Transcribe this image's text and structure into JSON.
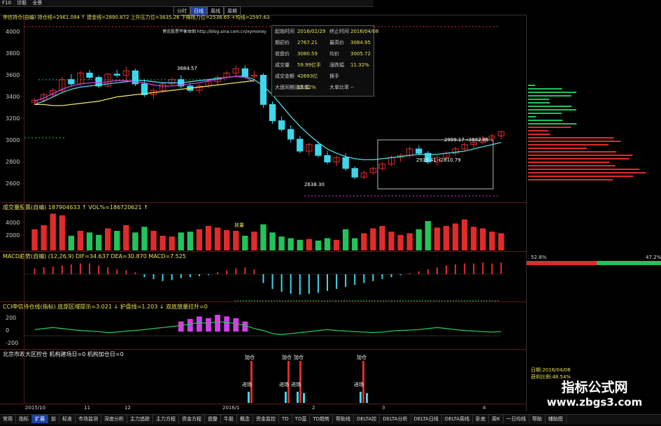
{
  "app": {
    "title": "F10",
    "tabs": [
      "诊股",
      "全景"
    ]
  },
  "period_buttons": [
    "分时",
    "日线",
    "周线",
    "周期"
  ],
  "price_panel": {
    "header": "申信持仓(自编) 持仓线=2961.094 ↑ 建金线=2890.872 上升压力位=3635.26 下降阻力位=2538.65 +均线=2597.63",
    "y_ticks": [
      "4000",
      "3800",
      "3600",
      "3400",
      "3200",
      "3000",
      "2800",
      "2600"
    ],
    "labels": {
      "high": "3684.57",
      "low": "2638.30",
      "mid": "2999.17→3882.85",
      "mid2": "2915.41→2810.79",
      "blog": "博克股票平衡体图  http://blog.sina.com.cn/xymoney"
    }
  },
  "info_box": {
    "rows": [
      [
        "起始时间",
        "2016/02/29",
        "终止时间",
        "2016/04/08"
      ],
      [
        "期初价",
        "2767.21",
        "最高价",
        "3084.95"
      ],
      [
        "收盘价",
        "3080.59",
        "均价",
        "3005.72"
      ],
      [
        "成交量",
        "59.99亿手",
        "涨跌幅",
        "11.32%"
      ],
      [
        "成交金额",
        "42693亿",
        "换手",
        ""
      ],
      [
        "大盘同期涨跌幅",
        "11.32%",
        "大单比率",
        "--"
      ]
    ]
  },
  "volume_panel": {
    "header": "成交量股票(自编)  187904633 ↑ VOL%=186720621 ↑",
    "y_ticks": [
      "4000",
      "2000"
    ],
    "label": "放量"
  },
  "macd_panel": {
    "header": "MACD趋势(自编) (12,26,9) DIF=34.637 DEA=30.870 MACD=7.525"
  },
  "cci_panel": {
    "header": "CCI申信持仓线(指标) 底部区域提示=3.021 ↓ 护盘线=1.203 ↓ 双底放量拉升=0",
    "y_ticks": [
      "200",
      "0",
      "-200"
    ]
  },
  "bottom_panel": {
    "header": "北京市政大区控仓 机构建场日=0 机构加仓日=0",
    "labels": [
      "加仓",
      "进场",
      "加仓",
      "进场",
      "加仓",
      "进场",
      "加仓",
      "进场"
    ]
  },
  "time_axis": [
    "2015/10",
    "11",
    "12",
    "2016/1",
    "2",
    "3",
    "4"
  ],
  "right_panel": {
    "left_pct": "52.8%",
    "right_pct": "47.2%",
    "date": "日期:2016/04/08",
    "profit": "获利比例:48.54%"
  },
  "bottom_tabs": [
    "常用",
    "指标",
    "扩展",
    "前",
    "标准",
    "市场监测",
    "深度分析",
    "主力追踪",
    "主力方程",
    "资金方程",
    "盘整",
    "牛股",
    "概念",
    "资金监控",
    "TD",
    "TD蓝",
    "TD趋势",
    "帮助线",
    "DELTA控",
    "DELTA分析",
    "DELTA日线",
    "DELTA周线",
    "卧底",
    "周K",
    "一日均线",
    "帮助",
    "辅助图"
  ],
  "watermark": {
    "line1": "指标公式网",
    "line2": "www.zbgs3.com"
  },
  "colors": {
    "up": "#e02b2b",
    "down": "#3fd6ec",
    "ma_purple": "#d23fe6",
    "ma_yellow": "#e8e25a",
    "ma_cyan": "#4fd9e6",
    "green": "#22c35a",
    "grid": "#5a1a1a"
  },
  "chart_data": {
    "type": "candlestick",
    "ylim": [
      2500,
      4100
    ],
    "candles": [
      [
        3350,
        3390,
        3320,
        3370
      ],
      [
        3370,
        3440,
        3350,
        3420
      ],
      [
        3420,
        3480,
        3400,
        3460
      ],
      [
        3460,
        3580,
        3440,
        3560
      ],
      [
        3560,
        3610,
        3500,
        3520
      ],
      [
        3520,
        3640,
        3500,
        3620
      ],
      [
        3620,
        3650,
        3560,
        3580
      ],
      [
        3580,
        3600,
        3480,
        3500
      ],
      [
        3500,
        3620,
        3490,
        3610
      ],
      [
        3610,
        3650,
        3580,
        3600
      ],
      [
        3600,
        3680,
        3560,
        3640
      ],
      [
        3640,
        3660,
        3500,
        3520
      ],
      [
        3520,
        3560,
        3400,
        3420
      ],
      [
        3420,
        3480,
        3380,
        3460
      ],
      [
        3460,
        3540,
        3440,
        3520
      ],
      [
        3520,
        3580,
        3500,
        3560
      ],
      [
        3560,
        3600,
        3480,
        3500
      ],
      [
        3500,
        3530,
        3440,
        3460
      ],
      [
        3460,
        3520,
        3430,
        3500
      ],
      [
        3500,
        3560,
        3480,
        3540
      ],
      [
        3540,
        3600,
        3510,
        3580
      ],
      [
        3580,
        3640,
        3560,
        3620
      ],
      [
        3620,
        3690,
        3590,
        3660
      ],
      [
        3660,
        3690,
        3570,
        3590
      ],
      [
        3590,
        3640,
        3560,
        3600
      ],
      [
        3600,
        3620,
        3300,
        3330
      ],
      [
        3330,
        3360,
        3150,
        3180
      ],
      [
        3180,
        3220,
        3080,
        3100
      ],
      [
        3100,
        3140,
        2980,
        3010
      ],
      [
        3010,
        3040,
        2880,
        2900
      ],
      [
        2900,
        2980,
        2860,
        2960
      ],
      [
        2960,
        2990,
        2840,
        2860
      ],
      [
        2860,
        2900,
        2780,
        2800
      ],
      [
        2800,
        2860,
        2760,
        2840
      ],
      [
        2840,
        2880,
        2720,
        2740
      ],
      [
        2740,
        2760,
        2640,
        2660
      ],
      [
        2660,
        2720,
        2638,
        2700
      ],
      [
        2700,
        2760,
        2680,
        2740
      ],
      [
        2740,
        2800,
        2720,
        2780
      ],
      [
        2780,
        2860,
        2760,
        2840
      ],
      [
        2840,
        2880,
        2800,
        2860
      ],
      [
        2860,
        2940,
        2840,
        2920
      ],
      [
        2920,
        2950,
        2860,
        2880
      ],
      [
        2880,
        2900,
        2780,
        2800
      ],
      [
        2800,
        2860,
        2767,
        2840
      ],
      [
        2840,
        2900,
        2820,
        2880
      ],
      [
        2880,
        2940,
        2860,
        2920
      ],
      [
        2920,
        2980,
        2900,
        2960
      ],
      [
        2960,
        3000,
        2930,
        2980
      ],
      [
        2980,
        3040,
        2960,
        3020
      ],
      [
        3020,
        3060,
        2990,
        3040
      ],
      [
        3040,
        3085,
        3010,
        3080
      ]
    ],
    "ma_cyan": [
      3330,
      3360,
      3400,
      3440,
      3470,
      3490,
      3500,
      3510,
      3520,
      3530,
      3540,
      3550,
      3550,
      3540,
      3530,
      3530,
      3530,
      3540,
      3550,
      3560,
      3570,
      3580,
      3590,
      3590,
      3560,
      3500,
      3420,
      3320,
      3220,
      3130,
      3050,
      2980,
      2920,
      2880,
      2850,
      2830,
      2820,
      2820,
      2830,
      2840,
      2850,
      2860,
      2870,
      2870,
      2870,
      2880,
      2890,
      2900,
      2920,
      2940,
      2960,
      2980
    ],
    "ma_purple": [
      3360,
      3390,
      3430,
      3470,
      3500,
      3520,
      3530,
      3530,
      3540,
      3550,
      3550,
      3540,
      3530,
      3510,
      3500,
      3500,
      3510,
      3520,
      3530,
      3550,
      3560,
      3580,
      3590,
      3580,
      3540
    ],
    "ma_yellow": [
      3330,
      3330,
      3320,
      3320,
      3330,
      3340,
      3350,
      3360,
      3380,
      3400,
      3410,
      3420,
      3430,
      3440,
      3450,
      3460,
      3470,
      3480,
      3490,
      3500,
      3510,
      3520,
      3530,
      3540,
      3550
    ],
    "volumes": [
      2600,
      3100,
      4500,
      4300,
      1800,
      2400,
      2200,
      1900,
      2700,
      2400,
      3100,
      2200,
      2900,
      2400,
      1800,
      1700,
      2200,
      2300,
      2600,
      3000,
      2800,
      2500,
      2400,
      1800,
      2300,
      3200,
      2200,
      1700,
      1500,
      1300,
      1400,
      1200,
      1500,
      1300,
      2600,
      1500,
      2100,
      2700,
      3000,
      2300,
      1900,
      2100,
      2600,
      3600,
      2800,
      3000,
      3300,
      3800,
      2900,
      2700,
      2300,
      2100
    ],
    "macd": [
      12,
      14,
      16,
      18,
      20,
      22,
      22,
      18,
      14,
      10,
      8,
      4,
      -6,
      -10,
      -14,
      -12,
      -8,
      -6,
      -4,
      -2,
      4,
      8,
      12,
      14,
      10,
      -18,
      -30,
      -36,
      -40,
      -42,
      -40,
      -38,
      -34,
      -30,
      -26,
      -22,
      -18,
      -14,
      -10,
      -6,
      -2,
      2,
      6,
      10,
      14,
      18,
      20,
      22,
      22,
      24,
      22,
      24
    ],
    "cci": [
      40,
      60,
      80,
      60,
      40,
      20,
      10,
      0,
      -20,
      -10,
      10,
      20,
      40,
      60,
      80,
      100,
      120,
      150,
      180,
      160,
      200,
      180,
      160,
      120,
      60,
      20,
      -40,
      -60,
      -40,
      -20,
      0,
      20,
      40,
      20,
      10,
      0,
      -10,
      -20,
      -10,
      10,
      20,
      30,
      40,
      60,
      80,
      60,
      40,
      20,
      10,
      0,
      -10,
      0
    ]
  }
}
